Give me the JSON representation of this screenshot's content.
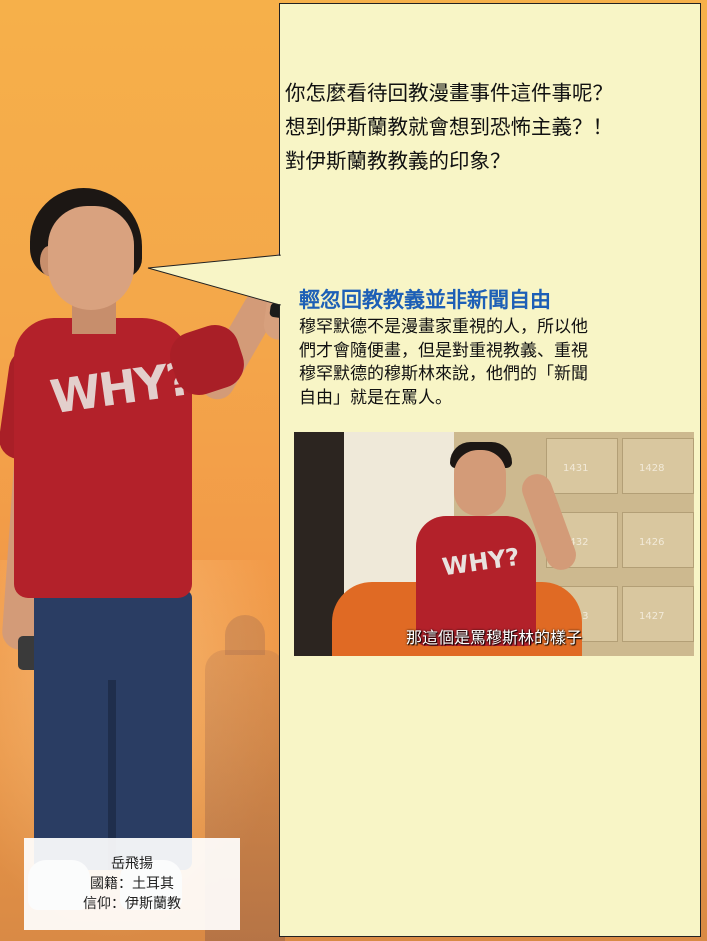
{
  "question": {
    "lines": [
      "你怎麼看待回教漫畫事件這件事呢？",
      "想到伊斯蘭教就會想到恐怖主義？！",
      "對伊斯蘭教教義的印象？"
    ]
  },
  "headline": "輕忽回教教義並非新聞自由",
  "body": {
    "lines": [
      "穆罕默德不是漫畫家重視的人，所以他",
      "們才會隨便畫，但是對重視教義、重視",
      "穆罕默德的穆斯林來說，他們的「新聞",
      "自由」就是在罵人。"
    ]
  },
  "video": {
    "subtitle": "那這個是罵穆斯林的樣子",
    "lockers": [
      "1431",
      "1428",
      "1432",
      "1426",
      "1433",
      "1427"
    ]
  },
  "shirt_text": "WHY?",
  "name_card": {
    "name": "岳飛揚",
    "nationality": "國籍：土耳其",
    "religion": "信仰：伊斯蘭教"
  },
  "colors": {
    "background": "#f4a74a",
    "panel": "#f8f5c6",
    "headline": "#1d5fb6"
  }
}
